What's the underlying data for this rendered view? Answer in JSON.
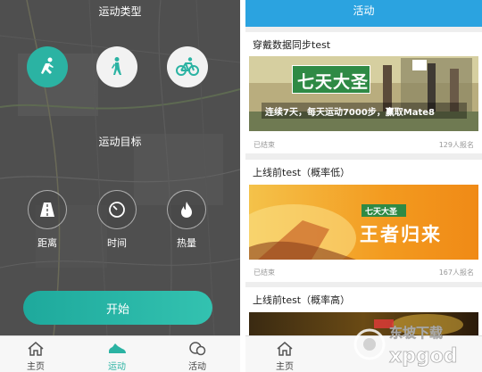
{
  "left_screen": {
    "sport_type_title": "运动类型",
    "sport_types": [
      {
        "icon": "run-icon",
        "active": true
      },
      {
        "icon": "walk-icon",
        "active": false
      },
      {
        "icon": "bike-icon",
        "active": false
      }
    ],
    "goal_title": "运动目标",
    "goals": [
      {
        "icon": "road-icon",
        "label": "距离"
      },
      {
        "icon": "clock-icon",
        "label": "时间"
      },
      {
        "icon": "flame-icon",
        "label": "热量"
      }
    ],
    "start_button": "开始",
    "tabs": [
      {
        "icon": "home-icon",
        "label": "主页",
        "active": false
      },
      {
        "icon": "shoe-icon",
        "label": "运动",
        "active": true
      },
      {
        "icon": "chat-icon",
        "label": "活动",
        "active": false
      }
    ]
  },
  "right_screen": {
    "header_title": "活动",
    "cards": [
      {
        "title": "穿戴数据同步test",
        "banner_headline": "七天大圣",
        "banner_subline": "连续7天，每天运动7000步，赢取Mate8",
        "status": "已结束",
        "count": "129人报名"
      },
      {
        "title": "上线前test（概率低）",
        "banner_tag": "七天大圣",
        "banner_headline": "王者归来",
        "status": "已结束",
        "count": "167人报名"
      },
      {
        "title": "上线前test（概率高）"
      }
    ],
    "tabs": [
      {
        "icon": "home-icon",
        "label": "主页"
      }
    ],
    "watermark_text": "东坡下载"
  },
  "colors": {
    "accent": "#2bb3a3",
    "header_blue": "#2ba3e0",
    "start_gradient_start": "#1ea99c",
    "start_gradient_end": "#33c2b0"
  }
}
